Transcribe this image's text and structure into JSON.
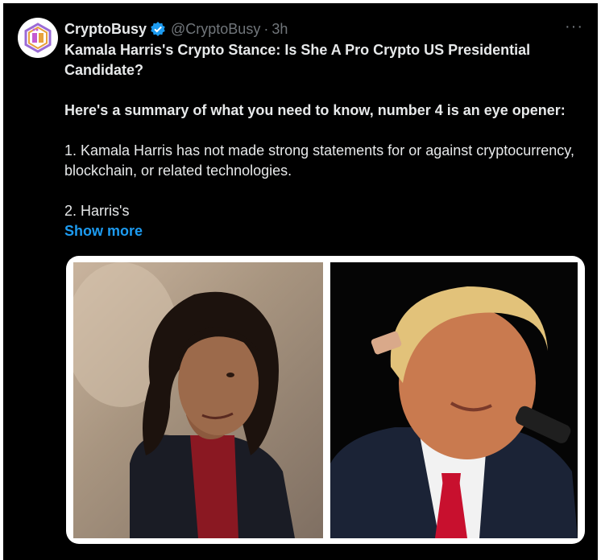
{
  "tweet": {
    "author_name": "CryptoBusy",
    "author_handle": "@CryptoBusy",
    "separator": "·",
    "time_ago": "3h",
    "more_label": "···",
    "headline": "Kamala Harris's Crypto Stance: Is She A Pro Crypto US Presidential Candidate?",
    "summary_intro": "Here's a summary of what you need to know, number 4 is an eye opener:",
    "point1": "1. Kamala Harris has not made strong statements for or against cryptocurrency, blockchain, or related technologies.",
    "point2": "2. Harris's",
    "show_more": "Show more"
  },
  "icons": {
    "verified": "verified-badge-icon",
    "avatar": "cryptobusy-logo-icon",
    "more": "more-options-icon"
  },
  "colors": {
    "background": "#000000",
    "text": "#e7e9ea",
    "muted": "#71767b",
    "link": "#1d9bf0",
    "verified": "#1d9bf0"
  }
}
